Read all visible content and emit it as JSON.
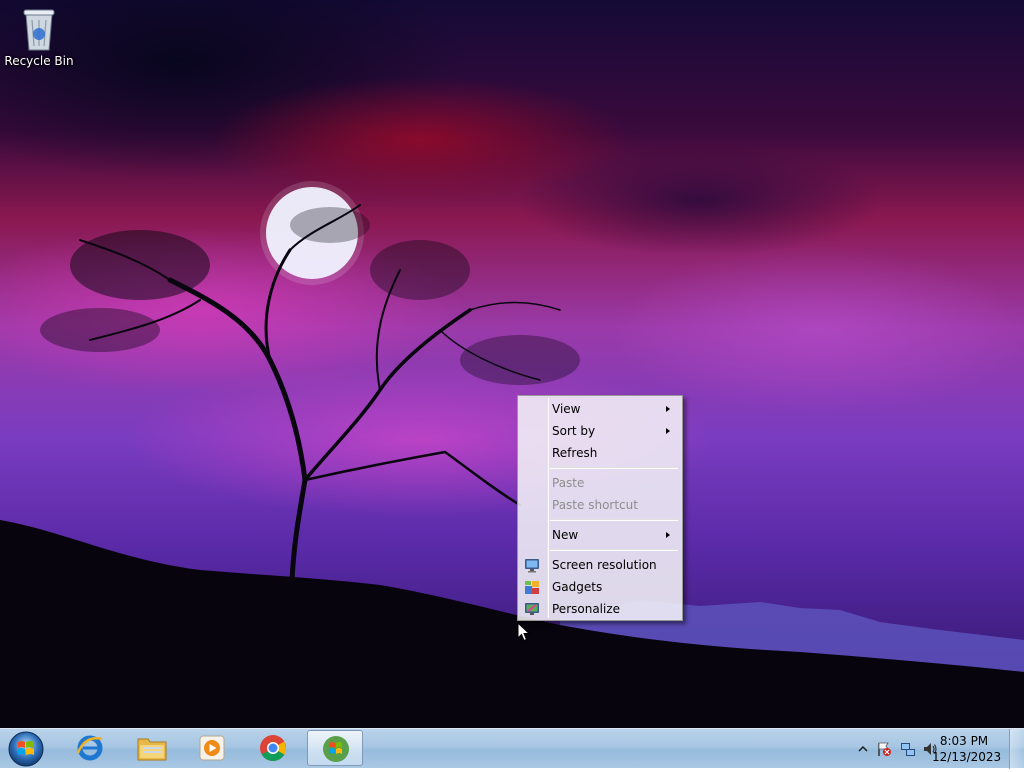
{
  "desktop": {
    "icons": [
      {
        "label": "Recycle Bin",
        "icon": "recycle-bin-icon"
      }
    ]
  },
  "context_menu": {
    "items": [
      {
        "label": "View",
        "submenu": true,
        "enabled": true
      },
      {
        "label": "Sort by",
        "submenu": true,
        "enabled": true
      },
      {
        "label": "Refresh",
        "submenu": false,
        "enabled": true
      },
      {
        "label": "Paste",
        "submenu": false,
        "enabled": false
      },
      {
        "label": "Paste shortcut",
        "submenu": false,
        "enabled": false
      },
      {
        "label": "New",
        "submenu": true,
        "enabled": true
      },
      {
        "label": "Screen resolution",
        "submenu": false,
        "enabled": true,
        "icon": "monitor-icon"
      },
      {
        "label": "Gadgets",
        "submenu": false,
        "enabled": true,
        "icon": "gadgets-icon"
      },
      {
        "label": "Personalize",
        "submenu": false,
        "enabled": true,
        "icon": "personalize-icon"
      }
    ]
  },
  "taskbar": {
    "start_icon": "windows-start-orb-icon",
    "pinned": [
      {
        "icon": "internet-explorer-icon",
        "active": false
      },
      {
        "icon": "file-explorer-icon",
        "active": false
      },
      {
        "icon": "media-player-icon",
        "active": false
      },
      {
        "icon": "chrome-icon",
        "active": false
      },
      {
        "icon": "windows-app-icon",
        "active": true
      }
    ],
    "tray": {
      "icons": [
        "show-hidden-icons-arrow",
        "action-center-flag-icon",
        "network-icon",
        "volume-icon"
      ],
      "time": "8:03 PM",
      "date": "12/13/2023"
    }
  },
  "colors": {
    "taskbar": "#a7c6e3",
    "menu_background": "#f6f6f8",
    "disabled_text": "#8d8d8d"
  }
}
